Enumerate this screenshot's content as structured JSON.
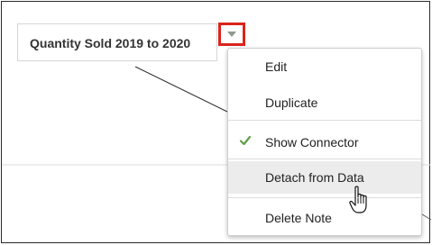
{
  "note": {
    "title": "Quantity Sold 2019 to 2020"
  },
  "menu": {
    "items": [
      {
        "label": "Edit",
        "checked": false
      },
      {
        "label": "Duplicate",
        "checked": false
      },
      {
        "label": "Show Connector",
        "checked": true
      },
      {
        "label": "Detach from Data",
        "checked": false,
        "hovered": true
      },
      {
        "label": "Delete Note",
        "checked": false
      }
    ]
  },
  "colors": {
    "highlight_border": "#d9241c",
    "checkmark": "#5f9f4a",
    "menu_hover": "#ececec"
  }
}
